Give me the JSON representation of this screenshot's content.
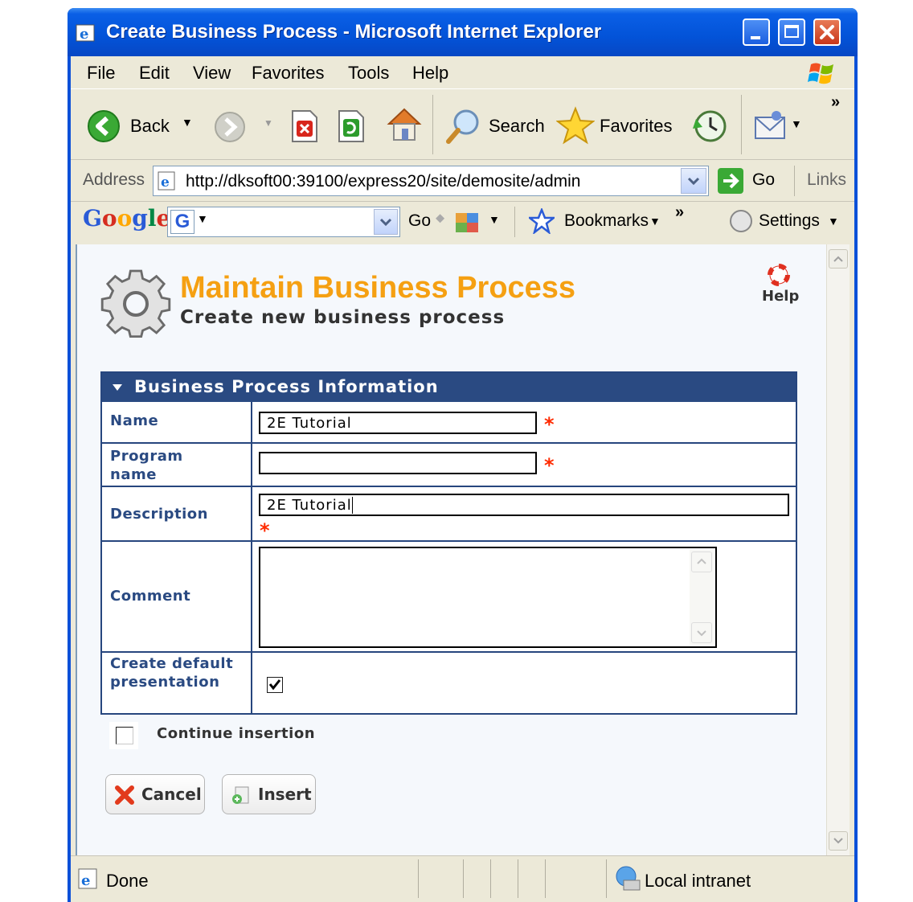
{
  "window": {
    "title": "Create Business Process - Microsoft Internet Explorer"
  },
  "menu": {
    "file": "File",
    "edit": "Edit",
    "view": "View",
    "favorites": "Favorites",
    "tools": "Tools",
    "help": "Help"
  },
  "toolbar": {
    "back": "Back",
    "search": "Search",
    "favorites": "Favorites",
    "chevron": "»"
  },
  "address": {
    "label": "Address",
    "url": "http://dksoft00:39100/express20/site/demosite/admin",
    "go": "Go",
    "links": "Links"
  },
  "google_bar": {
    "logo": "Google",
    "go": "Go",
    "bookmarks": "Bookmarks",
    "chevron": "»",
    "settings": "Settings"
  },
  "page": {
    "title": "Maintain Business Process",
    "subtitle": "Create new business process",
    "help": "Help",
    "section_title": "Business Process Information",
    "fields": {
      "name_label": "Name",
      "name_value": "2E Tutorial",
      "program_label": "Program name",
      "program_value": "",
      "description_label": "Description",
      "description_value": "2E Tutorial",
      "comment_label": "Comment",
      "comment_value": "",
      "default_presentation_label": "Create default presentation",
      "default_presentation_checked": true
    },
    "required_mark": "*",
    "continue_insertion": "Continue insertion",
    "continue_insertion_checked": false,
    "cancel": "Cancel",
    "insert": "Insert"
  },
  "status": {
    "text": "Done",
    "zone": "Local intranet"
  },
  "colors": {
    "title_orange": "#f5a012",
    "panel_blue": "#2a4a82",
    "required_red": "#ff2a00"
  }
}
